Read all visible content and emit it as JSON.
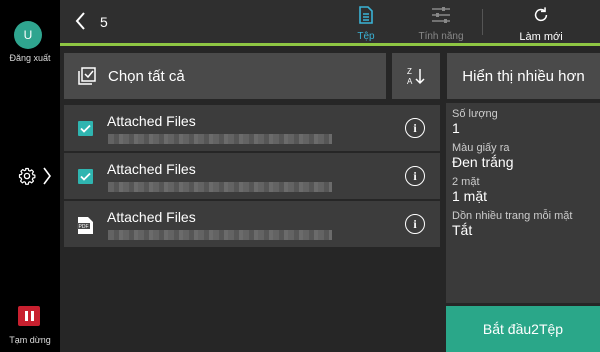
{
  "user": {
    "initial": "U",
    "logout_label": "Đăng xuất"
  },
  "rail": {
    "pause_label": "Tạm dừng"
  },
  "header": {
    "count": "5",
    "tabs": [
      {
        "label": "Tệp",
        "icon": "document-icon",
        "active": true
      },
      {
        "label": "Tính năng",
        "icon": "sliders-icon",
        "active": false
      },
      {
        "label": "Làm mới",
        "icon": "refresh-icon",
        "active": false
      }
    ]
  },
  "toolbar": {
    "select_all_label": "Chọn tất cả",
    "more_label": "Hiển thị nhiều hơn"
  },
  "files": [
    {
      "name": "Attached Files",
      "checked": true,
      "icon": "checkbox-checked"
    },
    {
      "name": "Attached Files",
      "checked": true,
      "icon": "checkbox-checked"
    },
    {
      "name": "Attached Files",
      "checked": false,
      "icon": "pdf-icon"
    }
  ],
  "summary": {
    "quantity_label": "Số lượng",
    "quantity_value": "1",
    "color_label": "Màu giấy ra",
    "color_value": "Đen trắng",
    "sides_label": "2 mặt",
    "sides_value": "1 mặt",
    "nup_label": "Dồn nhiều trang mỗi mặt",
    "nup_value": "Tắt"
  },
  "start_label": "Bắt đầu2Tệp",
  "colors": {
    "accent": "#8ec643",
    "teal": "#2aa789",
    "active_tab": "#3ab3d6",
    "pause": "#c8202f"
  }
}
